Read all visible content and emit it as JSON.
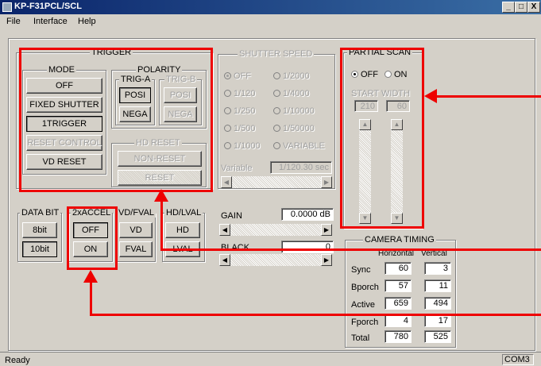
{
  "window": {
    "title": "KP-F31PCL/SCL",
    "min": "_",
    "max": "□",
    "close": "X"
  },
  "menu": [
    {
      "label": "File"
    },
    {
      "label": "Interface"
    },
    {
      "label": "Help"
    }
  ],
  "trigger": {
    "label": "TRIGGER",
    "mode": {
      "label": "MODE",
      "buttons": [
        "OFF",
        "FIXED SHUTTER",
        "1TRIGGER",
        "RESET CONTROL",
        "VD RESET"
      ]
    },
    "polarity": {
      "label": "POLARITY",
      "triga": {
        "label": "TRIG-A",
        "posi": "POSI",
        "nega": "NEGA"
      },
      "trigb": {
        "label": "TRIG-B",
        "posi": "POSI",
        "nega": "NEGA"
      }
    },
    "hdreset": {
      "label": "HD RESET",
      "nonreset": "NON-RESET",
      "reset": "RESET"
    }
  },
  "shutter": {
    "label": "SHUTTER SPEED",
    "options": [
      "OFF",
      "1/2000",
      "1/120",
      "1/4000",
      "1/250",
      "1/10000",
      "1/500",
      "1/50000",
      "1/1000",
      "VARIABLE"
    ],
    "variable_label": "Variable",
    "variable_value": "1/120.30 sec"
  },
  "partial": {
    "label": "PARTIAL SCAN",
    "off": "OFF",
    "on": "ON",
    "start_label": "START",
    "width_label": "WIDTH",
    "start_value": "210",
    "width_value": "60"
  },
  "databit": {
    "label": "DATA BIT",
    "b8": "8bit",
    "b10": "10bit"
  },
  "accel": {
    "label": "2xACCEL",
    "off": "OFF",
    "on": "ON"
  },
  "vdfval": {
    "label": "VD/FVAL",
    "vd": "VD",
    "fval": "FVAL"
  },
  "hdlval": {
    "label": "HD/LVAL",
    "hd": "HD",
    "lval": "LVAL"
  },
  "gain": {
    "label": "GAIN",
    "value": "0.0000 dB"
  },
  "black": {
    "label": "BLACK",
    "value": "0"
  },
  "timing": {
    "label": "CAMERA TIMING",
    "h_label": "Horizontal",
    "v_label": "Vertical",
    "rows": [
      {
        "name": "Sync",
        "h": "60",
        "v": "3"
      },
      {
        "name": "Bporch",
        "h": "57",
        "v": "11"
      },
      {
        "name": "Active",
        "h": "659",
        "v": "494"
      },
      {
        "name": "Fporch",
        "h": "4",
        "v": "17"
      },
      {
        "name": "Total",
        "h": "780",
        "v": "525"
      }
    ]
  },
  "status": {
    "text": "Ready",
    "port": "COM3"
  },
  "colors": {
    "annotation": "#e00000",
    "titlebar": "#0a246a",
    "face": "#d4d0c8"
  }
}
